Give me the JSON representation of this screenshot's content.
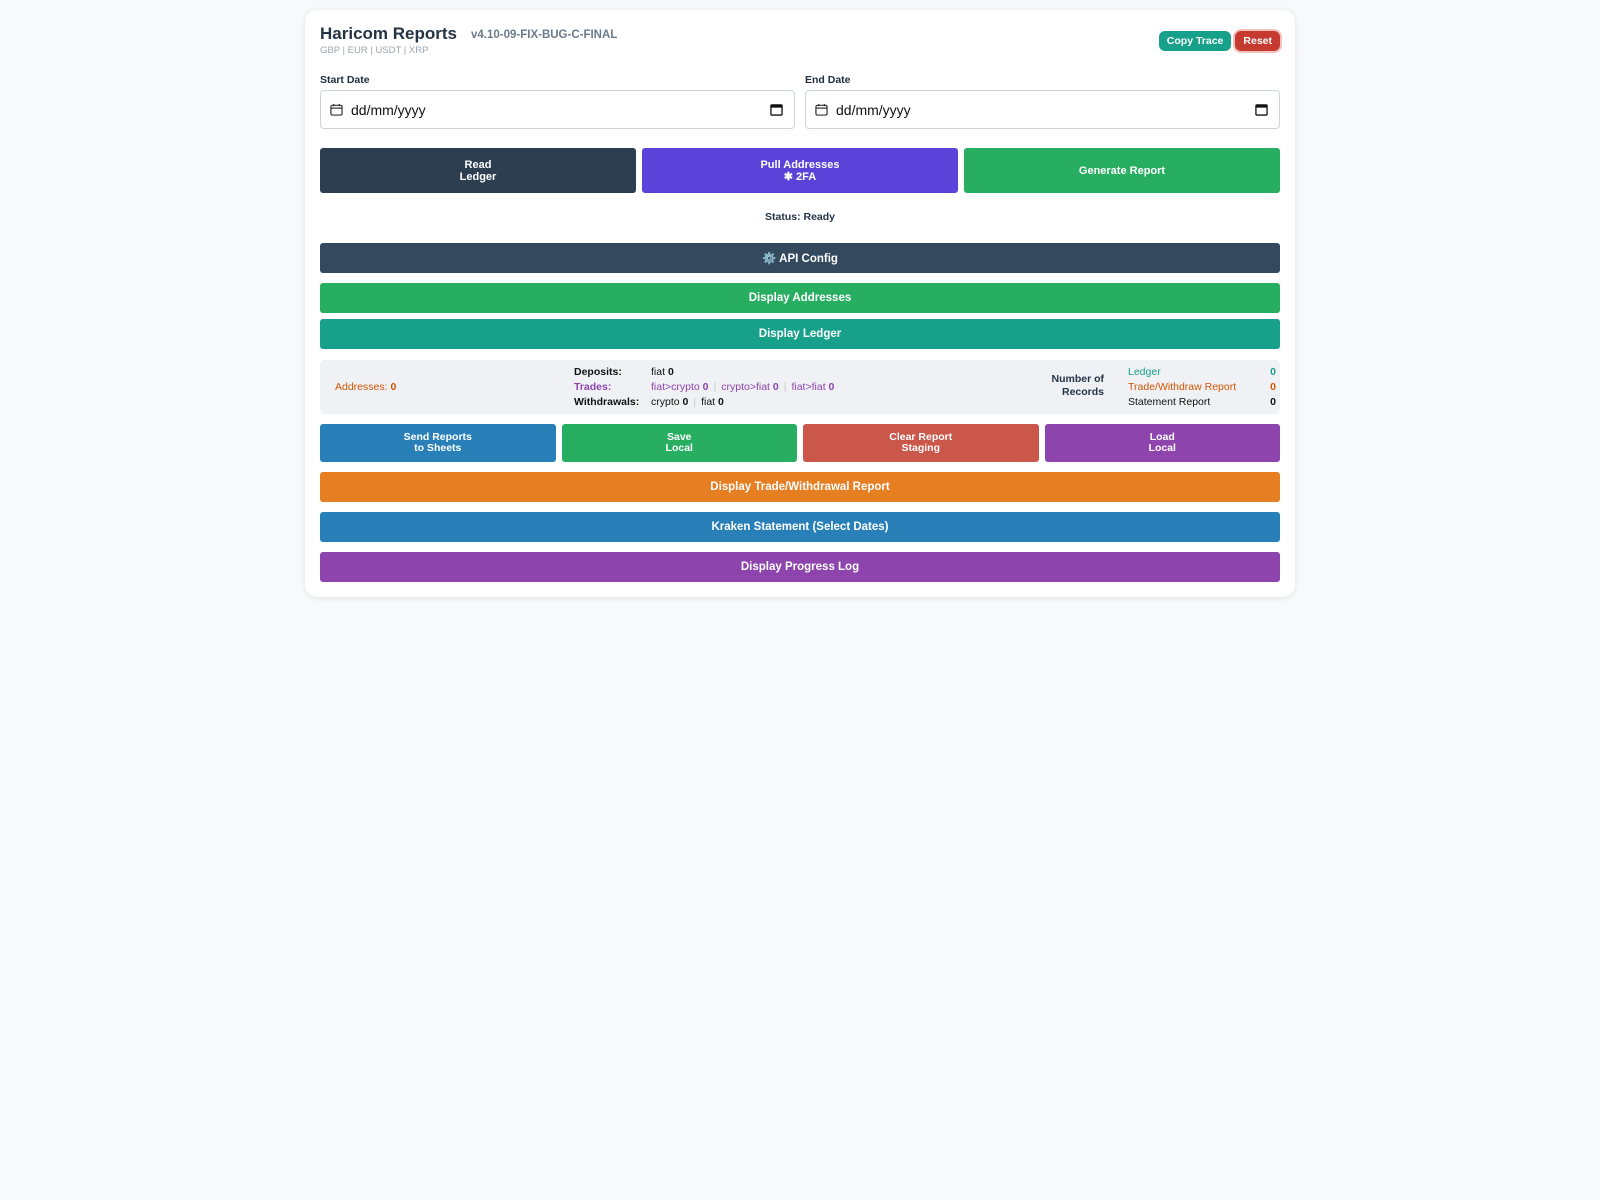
{
  "header": {
    "title": "Haricom Reports",
    "version": "v4.10-09-FIX-BUG-C-FINAL",
    "currencies": "GBP | EUR | USDT | XRP",
    "copy_label": "Copy Trace",
    "reset_label": "Reset"
  },
  "dates": {
    "start_label": "Start Date",
    "start_value": "dd/mm/yyyy",
    "end_label": "End Date",
    "end_value": "dd/mm/yyyy"
  },
  "main_buttons": {
    "read_line1": "Read",
    "read_line2": "Ledger",
    "pull_line1": "Pull Addresses",
    "pull_line2": "✱ 2FA",
    "generate": "Generate Report"
  },
  "status": "Status: Ready",
  "bars": {
    "api_config": "⚙️ API Config",
    "display_addresses": "Display Addresses",
    "display_ledger": "Display Ledger",
    "display_trade": "Display Trade/Withdrawal Report",
    "kraken": "Kraken Statement (Select Dates)",
    "progress": "Display Progress Log"
  },
  "summary": {
    "addresses_label": "Addresses:",
    "addresses_value": "0",
    "deposits_label": "Deposits:",
    "deposits_fiat_label": "fiat",
    "deposits_fiat_value": "0",
    "trades_label": "Trades:",
    "trades_fiat_crypto_label": "fiat>crypto",
    "trades_fiat_crypto_value": "0",
    "trades_crypto_fiat_label": "crypto>fiat",
    "trades_crypto_fiat_value": "0",
    "trades_fiat_fiat_label": "fiat>fiat",
    "trades_fiat_fiat_value": "0",
    "withdrawals_label": "Withdrawals:",
    "withdrawals_crypto_label": "crypto",
    "withdrawals_crypto_value": "0",
    "withdrawals_fiat_label": "fiat",
    "withdrawals_fiat_value": "0",
    "records_title_line1": "Number of",
    "records_title_line2": "Records",
    "records": [
      {
        "label": "Ledger",
        "value": "0"
      },
      {
        "label": "Trade/Withdraw Report",
        "value": "0"
      },
      {
        "label": "Statement Report",
        "value": "0"
      }
    ]
  },
  "secondary_buttons": {
    "send_line1": "Send Reports",
    "send_line2": "to Sheets",
    "save_line1": "Save",
    "save_line2": "Local",
    "clear_line1": "Clear Report",
    "clear_line2": "Staging",
    "load_line1": "Load",
    "load_line2": "Local"
  },
  "colors": {
    "dark": "#2c3e50",
    "purple_blue": "#5b42d9",
    "green": "#27ae60",
    "teal": "#17a08a",
    "orange": "#e67e22",
    "blue": "#2980b9",
    "purple": "#8e44ad",
    "red": "#c63a30"
  }
}
